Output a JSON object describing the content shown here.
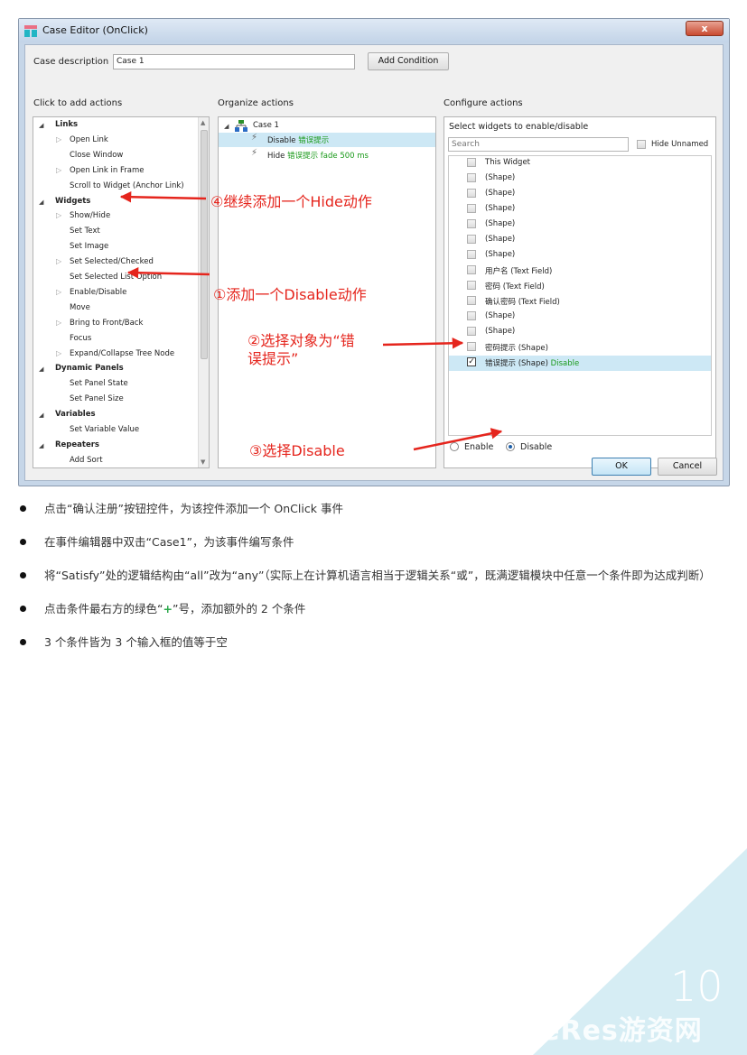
{
  "dialog": {
    "title": "Case Editor (OnClick)",
    "close_glyph": "x",
    "case_description_label": "Case description",
    "case_description_value": "Case 1",
    "add_condition_label": "Add Condition",
    "ok_label": "OK",
    "cancel_label": "Cancel"
  },
  "left_panel": {
    "heading": "Click to add actions",
    "items": [
      {
        "label": "Links",
        "kind": "group"
      },
      {
        "label": "Open Link",
        "kind": "expandable"
      },
      {
        "label": "Close Window",
        "kind": "leaf"
      },
      {
        "label": "Open Link in Frame",
        "kind": "expandable"
      },
      {
        "label": "Scroll to Widget (Anchor Link)",
        "kind": "leaf"
      },
      {
        "label": "Widgets",
        "kind": "group"
      },
      {
        "label": "Show/Hide",
        "kind": "expandable"
      },
      {
        "label": "Set Text",
        "kind": "leaf"
      },
      {
        "label": "Set Image",
        "kind": "leaf"
      },
      {
        "label": "Set Selected/Checked",
        "kind": "expandable"
      },
      {
        "label": "Set Selected List Option",
        "kind": "leaf"
      },
      {
        "label": "Enable/Disable",
        "kind": "expandable"
      },
      {
        "label": "Move",
        "kind": "leaf"
      },
      {
        "label": "Bring to Front/Back",
        "kind": "expandable"
      },
      {
        "label": "Focus",
        "kind": "leaf"
      },
      {
        "label": "Expand/Collapse Tree Node",
        "kind": "expandable"
      },
      {
        "label": "Dynamic Panels",
        "kind": "group"
      },
      {
        "label": "Set Panel State",
        "kind": "leaf"
      },
      {
        "label": "Set Panel Size",
        "kind": "leaf"
      },
      {
        "label": "Variables",
        "kind": "group"
      },
      {
        "label": "Set Variable Value",
        "kind": "leaf"
      },
      {
        "label": "Repeaters",
        "kind": "group"
      },
      {
        "label": "Add Sort",
        "kind": "leaf"
      }
    ]
  },
  "middle_panel": {
    "heading": "Organize actions",
    "case_label": "Case 1",
    "actions": [
      {
        "name": "Disable",
        "detail": "错误提示"
      },
      {
        "name": "Hide",
        "detail": "错误提示 fade 500 ms"
      }
    ]
  },
  "right_panel": {
    "heading": "Configure actions",
    "subheading": "Select widgets to enable/disable",
    "search_placeholder": "Search",
    "hide_unnamed_label": "Hide Unnamed",
    "widgets": [
      {
        "label": "This Widget",
        "checked": false,
        "status": ""
      },
      {
        "label": "(Shape)",
        "checked": false,
        "status": ""
      },
      {
        "label": "(Shape)",
        "checked": false,
        "status": ""
      },
      {
        "label": "(Shape)",
        "checked": false,
        "status": ""
      },
      {
        "label": "(Shape)",
        "checked": false,
        "status": ""
      },
      {
        "label": "(Shape)",
        "checked": false,
        "status": ""
      },
      {
        "label": "(Shape)",
        "checked": false,
        "status": ""
      },
      {
        "label": "用户名 (Text Field)",
        "checked": false,
        "status": ""
      },
      {
        "label": "密码 (Text Field)",
        "checked": false,
        "status": ""
      },
      {
        "label": "确认密码 (Text Field)",
        "checked": false,
        "status": ""
      },
      {
        "label": "(Shape)",
        "checked": false,
        "status": ""
      },
      {
        "label": "(Shape)",
        "checked": false,
        "status": ""
      },
      {
        "label": "密码提示 (Shape)",
        "checked": false,
        "status": ""
      },
      {
        "label": "错误提示 (Shape)",
        "checked": true,
        "status": "Disable"
      }
    ],
    "enable_label": "Enable",
    "disable_label": "Disable",
    "selected_mode": "Disable"
  },
  "annotations": {
    "step4": "④继续添加一个Hide动作",
    "step1": "①添加一个Disable动作",
    "step2_line1": "②选择对象为“错",
    "step2_line2": "误提示”",
    "step3": "③选择Disable"
  },
  "bullets": [
    {
      "text": "点击“确认注册”按钮控件，为该控件添加一个 OnClick 事件"
    },
    {
      "text": "在事件编辑器中双击“Case1”，为该事件编写条件"
    },
    {
      "text": "将“Satisfy”处的逻辑结构由“all”改为“any”（实际上在计算机语言相当于逻辑关系“或”，既满逻辑模块中任意一个条件即为达成判断）"
    },
    {
      "text_before": "点击条件最右方的绿色“",
      "plus": "+",
      "text_after": "”号，添加额外的 2 个条件"
    },
    {
      "text": "3 个条件皆为 3 个输入框的值等于空"
    }
  ],
  "page_number": "10",
  "watermark": "GameRes游资网",
  "colors": {
    "annotation_red": "#e5251d",
    "corner_triangle": "#d6edf4",
    "selection": "#cde8f5",
    "status_green": "#1a9a1a"
  }
}
